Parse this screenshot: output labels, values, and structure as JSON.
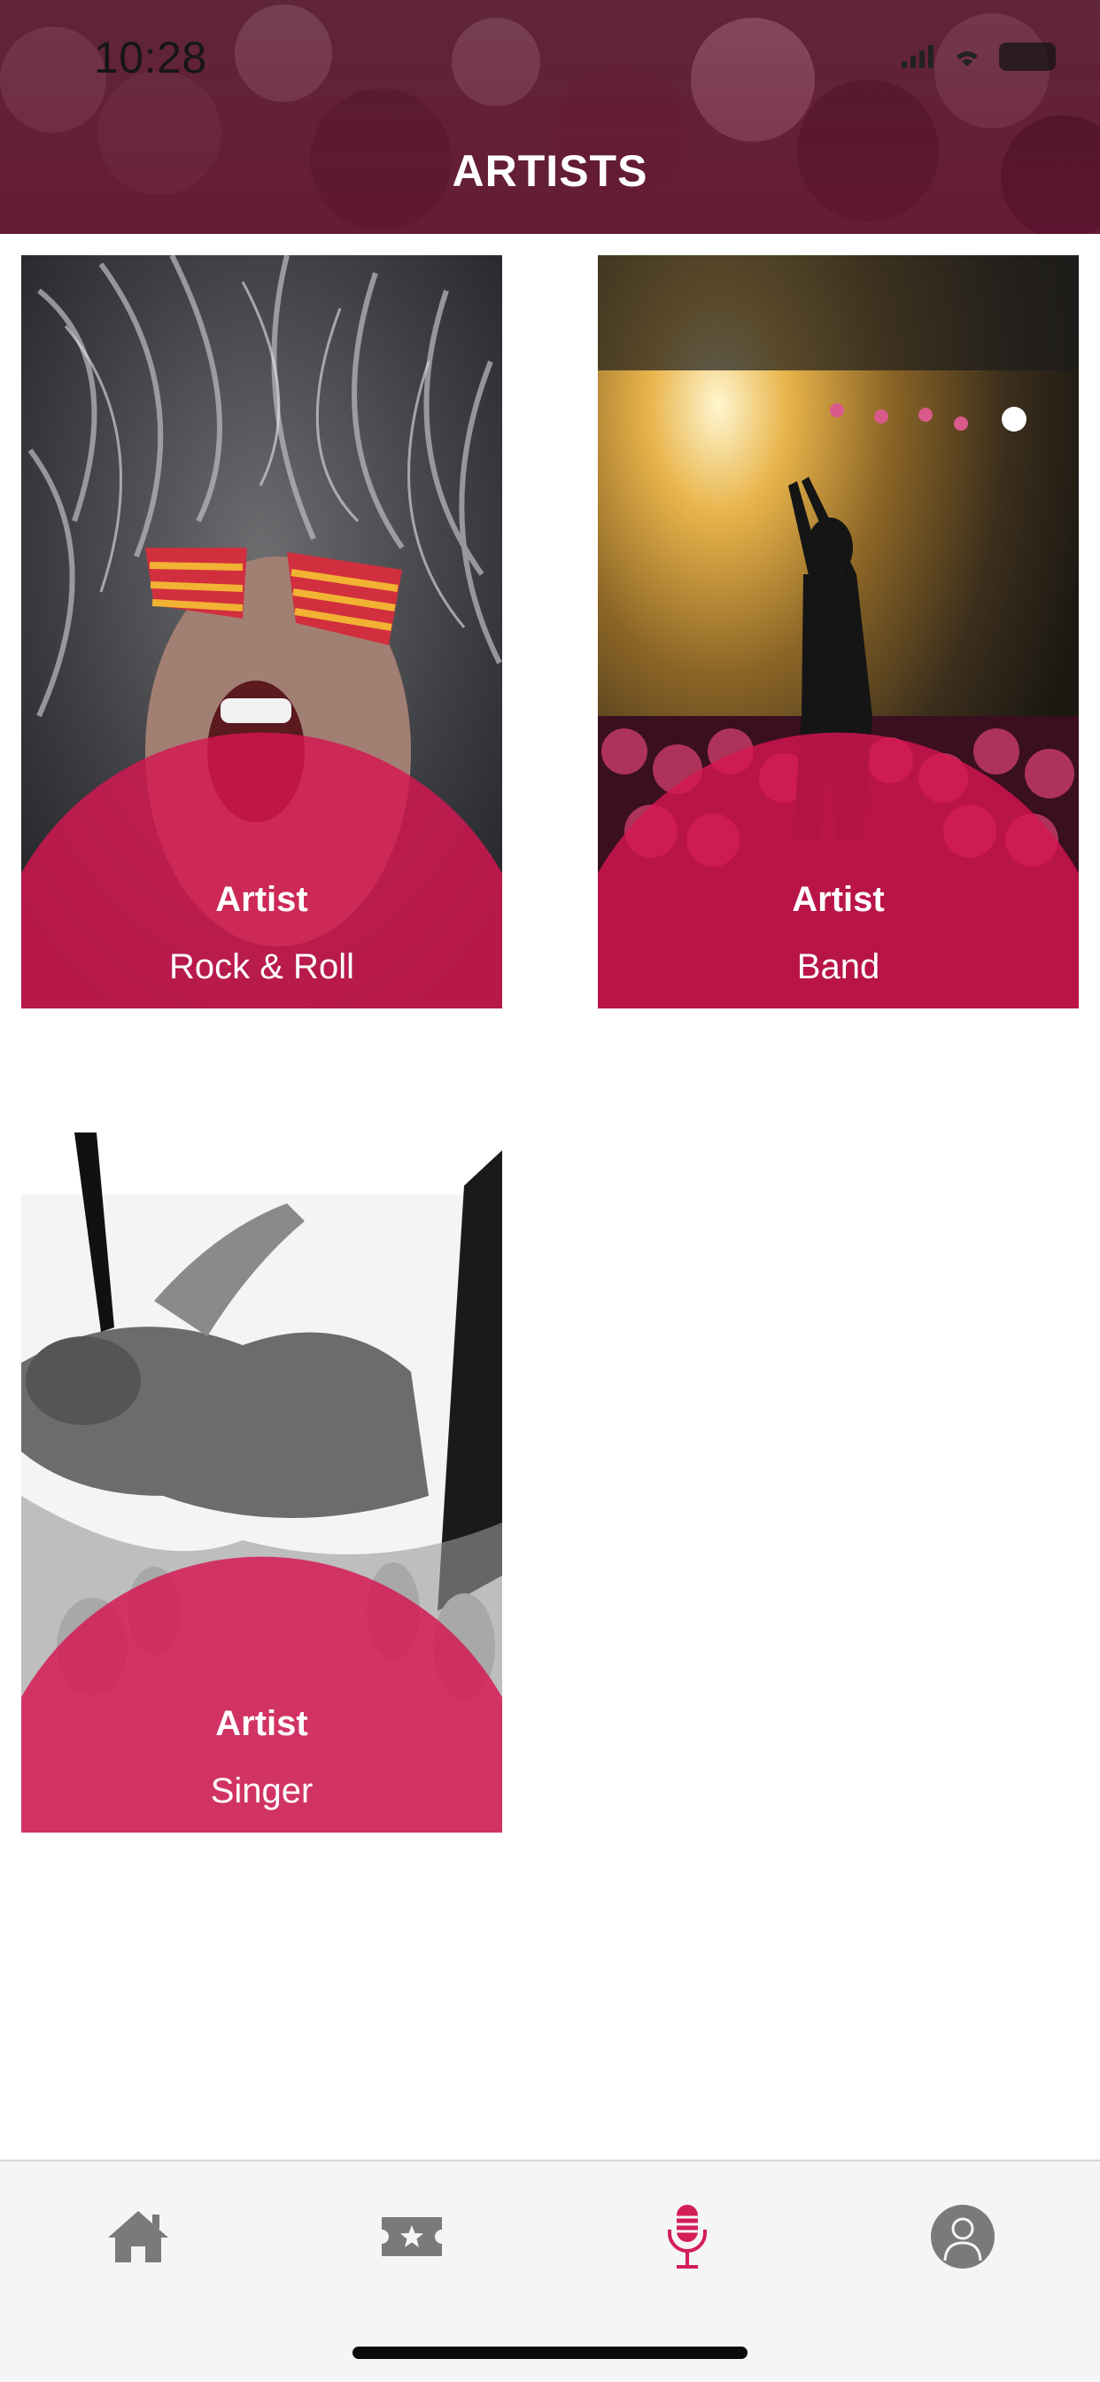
{
  "status_bar": {
    "time": "10:28"
  },
  "header": {
    "title": "ARTISTS"
  },
  "artists": [
    {
      "name": "Artist",
      "category": "Rock & Roll"
    },
    {
      "name": "Artist",
      "category": "Band"
    },
    {
      "name": "Artist",
      "category": "Singer"
    }
  ],
  "tabbar": {
    "items": [
      {
        "icon": "home-icon",
        "active": false
      },
      {
        "icon": "ticket-star-icon",
        "active": false
      },
      {
        "icon": "microphone-icon",
        "active": true
      },
      {
        "icon": "user-icon",
        "active": false
      }
    ]
  },
  "colors": {
    "accent": "#d41e57",
    "accent_overlay": "rgba(214,22,80,0.82)",
    "tab_inactive": "#7a7a7a",
    "tabbar_bg": "#f5f5f5"
  }
}
